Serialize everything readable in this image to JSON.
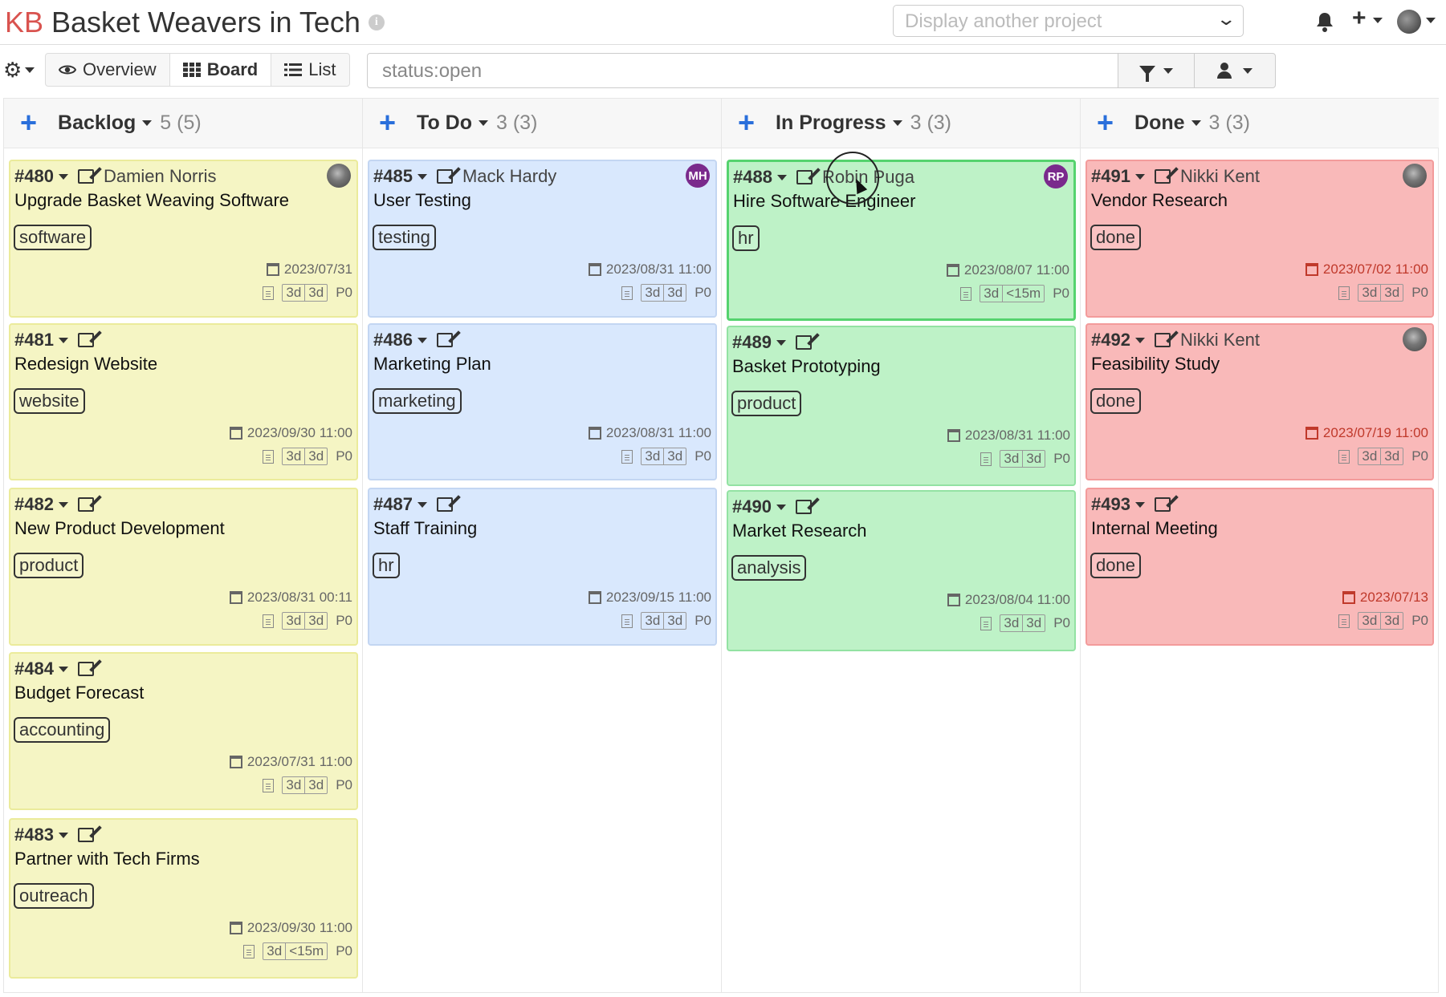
{
  "header": {
    "logo": "KB",
    "project_title": "Basket Weavers in Tech",
    "info_icon": "i",
    "project_select_placeholder": "Display another project"
  },
  "toolbar": {
    "views": [
      {
        "label": "Overview",
        "icon": "eye-icon"
      },
      {
        "label": "Board",
        "icon": "grid-icon"
      },
      {
        "label": "List",
        "icon": "list-icon"
      }
    ],
    "search_value": "status:open"
  },
  "columns": [
    {
      "title": "Backlog",
      "count": "5 (5)",
      "color": "#f5f5c4",
      "cards": [
        {
          "id": "#480",
          "owner": "Damien Norris",
          "avatar": "photo",
          "title": "Upgrade Basket Weaving Software",
          "tag": "software",
          "date": "2023/07/31",
          "est1": "3d",
          "est2": "3d",
          "priority": "P0"
        },
        {
          "id": "#481",
          "owner": "",
          "avatar": "",
          "title": "Redesign Website",
          "tag": "website",
          "date": "2023/09/30 11:00",
          "est1": "3d",
          "est2": "3d",
          "priority": "P0"
        },
        {
          "id": "#482",
          "owner": "",
          "avatar": "",
          "title": "New Product Development",
          "tag": "product",
          "date": "2023/08/31 00:11",
          "est1": "3d",
          "est2": "3d",
          "priority": "P0"
        },
        {
          "id": "#484",
          "owner": "",
          "avatar": "",
          "title": "Budget Forecast",
          "tag": "accounting",
          "date": "2023/07/31 11:00",
          "est1": "3d",
          "est2": "3d",
          "priority": "P0"
        },
        {
          "id": "#483",
          "owner": "",
          "avatar": "",
          "title": "Partner with Tech Firms",
          "tag": "outreach",
          "date": "2023/09/30 11:00",
          "est1": "3d",
          "est2": "<15m",
          "priority": "P0"
        }
      ]
    },
    {
      "title": "To Do",
      "count": "3 (3)",
      "color": "#d9e8fd",
      "cards": [
        {
          "id": "#485",
          "owner": "Mack Hardy",
          "avatar": "MH",
          "title": "User Testing",
          "tag": "testing",
          "date": "2023/08/31 11:00",
          "est1": "3d",
          "est2": "3d",
          "priority": "P0"
        },
        {
          "id": "#486",
          "owner": "",
          "avatar": "",
          "title": "Marketing Plan",
          "tag": "marketing",
          "date": "2023/08/31 11:00",
          "est1": "3d",
          "est2": "3d",
          "priority": "P0"
        },
        {
          "id": "#487",
          "owner": "",
          "avatar": "",
          "title": "Staff Training",
          "tag": "hr",
          "date": "2023/09/15 11:00",
          "est1": "3d",
          "est2": "3d",
          "priority": "P0"
        }
      ]
    },
    {
      "title": "In Progress",
      "count": "3 (3)",
      "color": "#bef2c7",
      "cards": [
        {
          "id": "#488",
          "owner": "Robin Puga",
          "avatar": "RP",
          "title": "Hire Software Engineer",
          "tag": "hr",
          "date": "2023/08/07 11:00",
          "est1": "3d",
          "est2": "<15m",
          "priority": "P0"
        },
        {
          "id": "#489",
          "owner": "",
          "avatar": "",
          "title": "Basket Prototyping",
          "tag": "product",
          "date": "2023/08/31 11:00",
          "est1": "3d",
          "est2": "3d",
          "priority": "P0"
        },
        {
          "id": "#490",
          "owner": "",
          "avatar": "",
          "title": "Market Research",
          "tag": "analysis",
          "date": "2023/08/04 11:00",
          "est1": "3d",
          "est2": "3d",
          "priority": "P0"
        }
      ]
    },
    {
      "title": "Done",
      "count": "3 (3)",
      "color": "#f9b9b9",
      "cards": [
        {
          "id": "#491",
          "owner": "Nikki Kent",
          "avatar": "photo",
          "title": "Vendor Research",
          "tag": "done",
          "date": "2023/07/02 11:00",
          "est1": "3d",
          "est2": "3d",
          "priority": "P0"
        },
        {
          "id": "#492",
          "owner": "Nikki Kent",
          "avatar": "photo",
          "title": "Feasibility Study",
          "tag": "done",
          "date": "2023/07/19 11:00",
          "est1": "3d",
          "est2": "3d",
          "priority": "P0"
        },
        {
          "id": "#493",
          "owner": "",
          "avatar": "",
          "title": "Internal Meeting",
          "tag": "done",
          "date": "2023/07/13",
          "est1": "3d",
          "est2": "3d",
          "priority": "P0"
        }
      ]
    }
  ]
}
